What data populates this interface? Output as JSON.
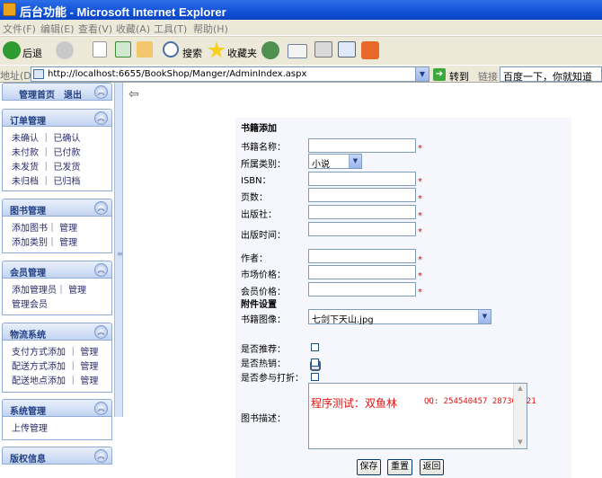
{
  "window": {
    "title": "后台功能 - Microsoft Internet Explorer"
  },
  "menu": [
    "文件(F)",
    "编辑(E)",
    "查看(V)",
    "收藏(A)",
    "工具(T)",
    "帮助(H)"
  ],
  "toolbar": {
    "back_label": "后退",
    "search_label": "搜索",
    "favorites_label": "收藏夹"
  },
  "address": {
    "label": "地址(D)",
    "url": "http://localhost:6655/BookShop/Manger/AdminIndex.aspx",
    "go_label": "转到",
    "links_label": "链接",
    "search_box": "百度一下，你就知道"
  },
  "nav": {
    "top": {
      "home": "管理首页",
      "logout": "退出"
    },
    "sections": [
      {
        "title": "订单管理",
        "lines": [
          "未确认 ｜ 已确认",
          "未付款 ｜ 已付款",
          "未发货 ｜ 已发货",
          "未归档 ｜ 已归档"
        ]
      },
      {
        "title": "图书管理",
        "lines": [
          "添加图书｜ 管理",
          "添加类别｜ 管理"
        ]
      },
      {
        "title": "会员管理",
        "lines": [
          "添加管理员｜ 管理",
          "管理会员"
        ]
      },
      {
        "title": "物流系统",
        "lines": [
          "支付方式添加 ｜ 管理",
          "配送方式添加 ｜ 管理",
          "配送地点添加 ｜ 管理"
        ]
      },
      {
        "title": "系统管理",
        "lines": [
          "上传管理"
        ]
      },
      {
        "title": "版权信息",
        "lines": []
      }
    ]
  },
  "form": {
    "heading": "书籍添加",
    "fields": {
      "name": "书籍名称：",
      "category": "所属类别：",
      "isbn": "ISBN：",
      "pages": "页数：",
      "publisher": "出版社：",
      "pubdate": "出版时间：",
      "author": "作者：",
      "market_price": "市场价格：",
      "member_price": "会员价格："
    },
    "category_value": "小说",
    "required_mark": "*",
    "attachment_heading": "附件设置",
    "image_label": "书籍图像：",
    "image_value": "七剑下天山.jpg",
    "recommend_label": "是否推荐：",
    "hot_label": "是否热销：",
    "discount_label": "是否参与打折：",
    "desc_label": "图书描述：",
    "desc_text_1": "程序测试：双鱼林",
    "desc_text_2": "QQ: 254540457 287307421",
    "buttons": {
      "save": "保存",
      "reset": "重置",
      "back": "返回"
    }
  }
}
